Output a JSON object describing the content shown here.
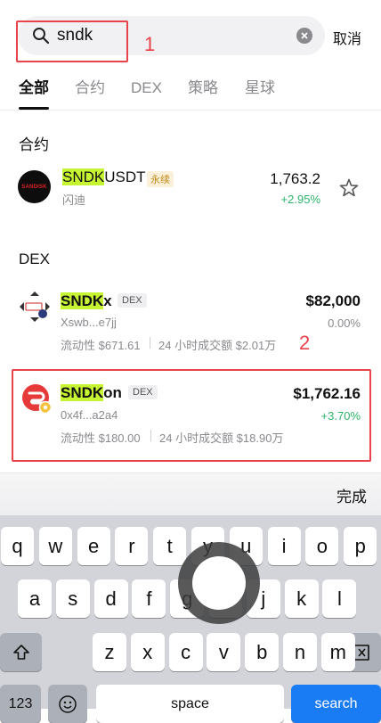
{
  "search": {
    "value": "sndk",
    "cancel_label": "取消"
  },
  "annotations": {
    "one": "1",
    "two": "2"
  },
  "tabs": [
    {
      "label": "全部",
      "active": true
    },
    {
      "label": "合约"
    },
    {
      "label": "DEX"
    },
    {
      "label": "策略"
    },
    {
      "label": "星球"
    }
  ],
  "contracts_section": {
    "title": "合约",
    "item": {
      "symbol_highlight": "SNDK",
      "symbol_rest": "USDT",
      "badge": "永续",
      "subtitle": "闪迪",
      "price": "1,763.2",
      "change": "+2.95%",
      "logo_text": "SANDISK"
    }
  },
  "dex_section": {
    "title": "DEX",
    "items": [
      {
        "symbol_highlight": "SNDK",
        "symbol_rest": "x",
        "badge": "DEX",
        "address": "Xswb...e7jj",
        "liquidity": "流动性 $671.61",
        "volume": "24 小时成交额 $2.01万",
        "price": "$82,000",
        "change": "0.00%"
      },
      {
        "symbol_highlight": "SNDK",
        "symbol_rest": "on",
        "badge": "DEX",
        "address": "0x4f...a2a4",
        "liquidity": "流动性 $180.00",
        "volume": "24 小时成交额 $18.90万",
        "price": "$1,762.16",
        "change": "+3.70%"
      }
    ]
  },
  "keyboard": {
    "done_label": "完成",
    "row1": [
      "q",
      "w",
      "e",
      "r",
      "t",
      "y",
      "u",
      "i",
      "o",
      "p"
    ],
    "row2": [
      "a",
      "s",
      "d",
      "f",
      "g",
      "h",
      "j",
      "k",
      "l"
    ],
    "row3": [
      "z",
      "x",
      "c",
      "v",
      "b",
      "n",
      "m"
    ],
    "numbers_label": "123",
    "space_label": "space",
    "search_label": "search"
  },
  "colors": {
    "highlight": "#c6f432",
    "positive": "#2fb36b",
    "annotation": "#e8424a",
    "accent": "#1a7cf5"
  }
}
